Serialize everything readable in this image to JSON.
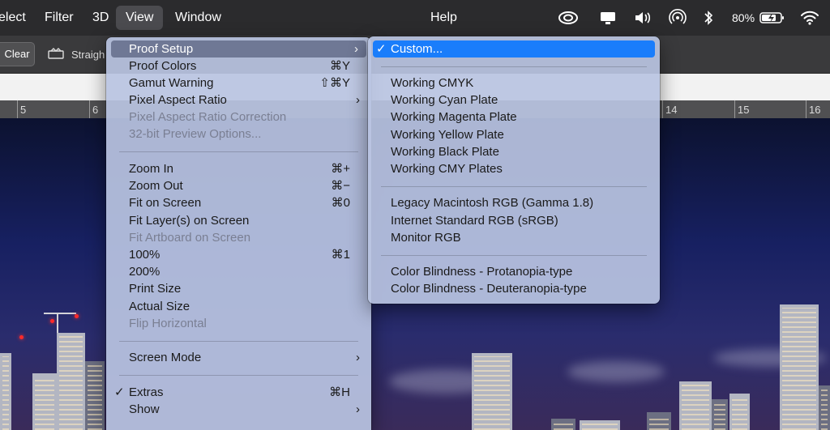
{
  "menubar": {
    "items": [
      "elect",
      "Filter",
      "3D",
      "View",
      "Window",
      "Help"
    ],
    "active": "View",
    "battery": "80%"
  },
  "options": {
    "clear": "Clear",
    "straighten": "Straigh"
  },
  "ruler": [
    "5",
    "6",
    "14",
    "15",
    "16"
  ],
  "view_menu": {
    "proof_setup": "Proof Setup",
    "proof_colors": "Proof Colors",
    "proof_colors_sc": "⌘Y",
    "gamut_warning": "Gamut Warning",
    "gamut_warning_sc": "⇧⌘Y",
    "pixel_aspect_ratio": "Pixel Aspect Ratio",
    "pixel_aspect_correction": "Pixel Aspect Ratio Correction",
    "preview_32bit": "32-bit Preview Options...",
    "zoom_in": "Zoom In",
    "zoom_in_sc": "⌘+",
    "zoom_out": "Zoom Out",
    "zoom_out_sc": "⌘−",
    "fit_on_screen": "Fit on Screen",
    "fit_on_screen_sc": "⌘0",
    "fit_layers": "Fit Layer(s) on Screen",
    "fit_artboard": "Fit Artboard on Screen",
    "p100": "100%",
    "p100_sc": "⌘1",
    "p200": "200%",
    "print_size": "Print Size",
    "actual_size": "Actual Size",
    "flip_horizontal": "Flip Horizontal",
    "screen_mode": "Screen Mode",
    "extras": "Extras",
    "extras_sc": "⌘H",
    "show": "Show"
  },
  "proof_submenu": {
    "custom": "Custom...",
    "working_cmyk": "Working CMYK",
    "cyan": "Working Cyan Plate",
    "magenta": "Working Magenta Plate",
    "yellow": "Working Yellow Plate",
    "black": "Working Black Plate",
    "cmy": "Working CMY Plates",
    "legacy_mac": "Legacy Macintosh RGB (Gamma 1.8)",
    "srgb": "Internet Standard RGB (sRGB)",
    "monitor": "Monitor RGB",
    "protanopia": "Color Blindness - Protanopia-type",
    "deuteranopia": "Color Blindness - Deuteranopia-type"
  },
  "icons": {
    "check": "✓",
    "arrow": "›"
  }
}
